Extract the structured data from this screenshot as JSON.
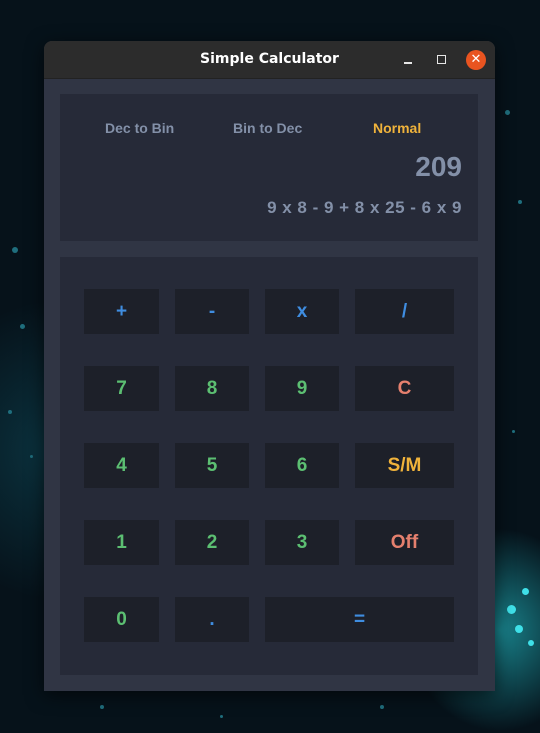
{
  "window": {
    "title": "Simple Calculator"
  },
  "modes": [
    {
      "label": "Dec to Bin",
      "active": false
    },
    {
      "label": "Bin to Dec",
      "active": false
    },
    {
      "label": "Normal",
      "active": true
    }
  ],
  "display": {
    "result": "209",
    "expression": "9 x 8 - 9 + 8 x 25 - 6 x 9"
  },
  "keys": {
    "plus": "+",
    "minus": "-",
    "multiply": "x",
    "divide": "/",
    "seven": "7",
    "eight": "8",
    "nine": "9",
    "clear": "C",
    "four": "4",
    "five": "5",
    "six": "6",
    "sign_mode": "S/M",
    "one": "1",
    "two": "2",
    "three": "3",
    "off": "Off",
    "zero": "0",
    "dot": ".",
    "equals": "="
  },
  "colors": {
    "operator": "#3f8de0",
    "digit": "#5cbf72",
    "clear_off": "#e5806e",
    "active_mode_and_sm": "#f0b33b",
    "close_button": "#e95420"
  }
}
